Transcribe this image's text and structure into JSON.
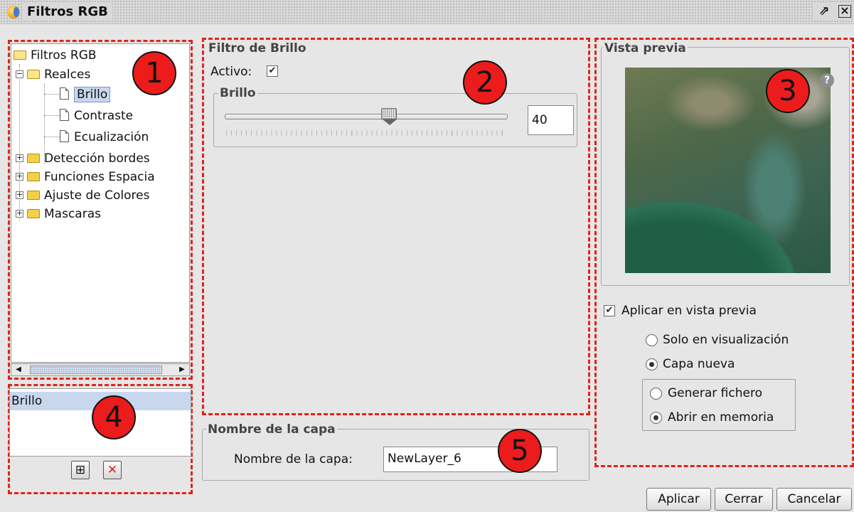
{
  "window": {
    "title": "Filtros RGB"
  },
  "tree": {
    "root": "Filtros RGB",
    "groups": [
      {
        "label": "Realces",
        "expanded": true,
        "children": [
          "Brillo",
          "Contraste",
          "Ecualización"
        ],
        "selected": "Brillo"
      },
      {
        "label": "Detección bordes"
      },
      {
        "label": "Funciones Espacia"
      },
      {
        "label": "Ajuste de Colores"
      },
      {
        "label": "Mascaras"
      }
    ]
  },
  "filter_list": {
    "items": [
      "Brillo"
    ]
  },
  "brightness": {
    "group_title": "Filtro de Brillo",
    "active_label": "Activo:",
    "active": true,
    "sub_title": "Brillo",
    "value": "40",
    "slider_fraction": 0.58
  },
  "layer_name": {
    "group_title": "Nombre de la capa",
    "label": "Nombre de la capa:",
    "value": "NewLayer_6"
  },
  "preview": {
    "group_title": "Vista previa",
    "apply_label": "Aplicar en vista previa",
    "apply_checked": true,
    "options": [
      "Solo en visualización",
      "Capa nueva"
    ],
    "selected_option": "Capa nueva",
    "sub_options": [
      "Generar fichero",
      "Abrir en memoria"
    ],
    "selected_sub_option": "Abrir en memoria",
    "help_glyph": "?"
  },
  "buttons": {
    "apply": "Aplicar",
    "close": "Cerrar",
    "cancel": "Cancelar"
  },
  "annotations": [
    "1",
    "2",
    "3",
    "4",
    "5"
  ],
  "colors": {
    "annotation_red": "#ec1c1c",
    "selection": "#c8d7ee"
  }
}
